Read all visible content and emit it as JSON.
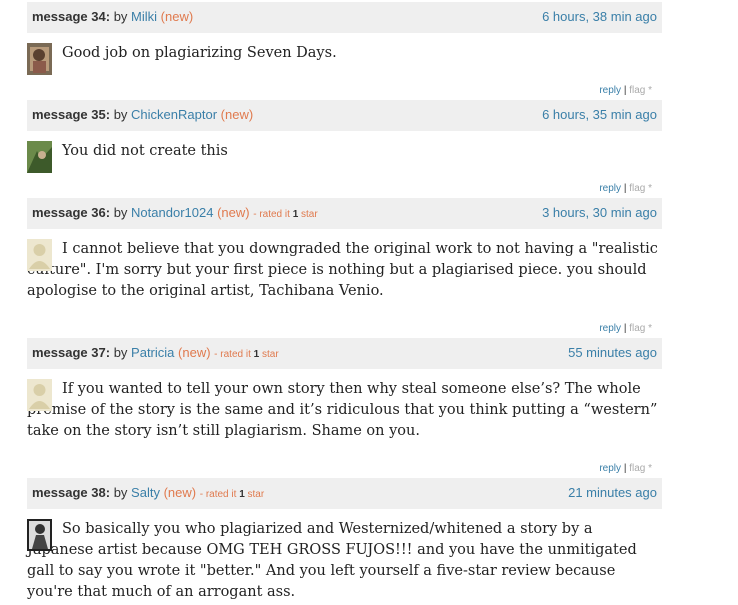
{
  "messages": [
    {
      "num": "message 34:",
      "by": "by",
      "author": "Milki",
      "new": "(new)",
      "rated": "",
      "stars": "",
      "star_word": "",
      "time": "6 hours, 38 min ago",
      "text": "Good job on plagiarizing Seven Days.",
      "reply": "reply",
      "sep": "|",
      "flag": "flag *"
    },
    {
      "num": "message 35:",
      "by": "by",
      "author": "ChickenRaptor",
      "new": "(new)",
      "rated": "",
      "stars": "",
      "star_word": "",
      "time": "6 hours, 35 min ago",
      "text": "You did not create this",
      "reply": "reply",
      "sep": "|",
      "flag": "flag *"
    },
    {
      "num": "message 36:",
      "by": "by",
      "author": "Notandor1024",
      "new": "(new)",
      "rated": "- rated it",
      "stars": "1",
      "star_word": "star",
      "time": "3 hours, 30 min ago",
      "text": "I cannot believe that you downgraded the original work to not having a \"realistic culture\". I'm sorry but your first piece is nothing but a plagiarised piece. you should apologise to the original artist, Tachibana Venio.",
      "reply": "reply",
      "sep": "|",
      "flag": "flag *"
    },
    {
      "num": "message 37:",
      "by": "by",
      "author": "Patricia",
      "new": "(new)",
      "rated": "- rated it",
      "stars": "1",
      "star_word": "star",
      "time": "55 minutes ago",
      "text": "If you wanted to tell your own story then why steal someone else’s? The whole premise of the story is the same and it’s ridiculous that you think putting a “western” take on the story isn’t still plagiarism. Shame on you.",
      "reply": "reply",
      "sep": "|",
      "flag": "flag *"
    },
    {
      "num": "message 38:",
      "by": "by",
      "author": "Salty",
      "new": "(new)",
      "rated": "- rated it",
      "stars": "1",
      "star_word": "star",
      "time": "21 minutes ago",
      "text": "So basically you who plagiarized and Westernized/whitened a story by a Japanese artist because OMG TEH GROSS FUJOS!!! and you have the unmitigated gall to say you wrote it \"better.\" And you left yourself a five-star review because you're that much of an arrogant ass.",
      "reply": "",
      "sep": "",
      "flag": ""
    }
  ],
  "colors": {
    "link": "#3a7fa8",
    "new": "#e07a4e",
    "header_bg": "#efefef"
  }
}
